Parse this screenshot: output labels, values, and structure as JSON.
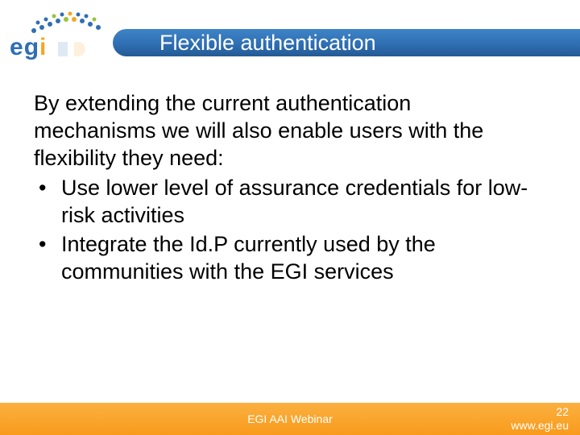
{
  "header": {
    "title": "Flexible authentication",
    "logo_text_e": "e",
    "logo_text_g": "g",
    "logo_text_i": "i"
  },
  "body": {
    "intro": "By extending the current authentication mechanisms we will also enable users with the flexibility they need:",
    "bullets": [
      "Use lower level of assurance credentials for low-risk activities",
      "Integrate the Id.P currently used by the communities with the EGI services"
    ]
  },
  "footer": {
    "center": "EGI AAI Webinar",
    "page": "22",
    "url": "www.egi.eu"
  }
}
